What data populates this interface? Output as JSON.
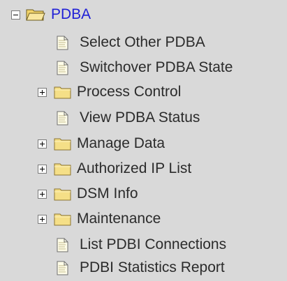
{
  "tree": {
    "root": {
      "label": "PDBA",
      "expanded": true,
      "icon": "folder-open-icon"
    },
    "items": [
      {
        "label": "Select Other PDBA",
        "type": "page",
        "icon": "page-icon"
      },
      {
        "label": "Switchover PDBA State",
        "type": "page",
        "icon": "page-icon"
      },
      {
        "label": "Process Control",
        "type": "folder",
        "icon": "folder-icon",
        "expanded": false
      },
      {
        "label": "View PDBA Status",
        "type": "page",
        "icon": "page-icon"
      },
      {
        "label": "Manage Data",
        "type": "folder",
        "icon": "folder-icon",
        "expanded": false
      },
      {
        "label": "Authorized IP List",
        "type": "folder",
        "icon": "folder-icon",
        "expanded": false
      },
      {
        "label": "DSM Info",
        "type": "folder",
        "icon": "folder-icon",
        "expanded": false
      },
      {
        "label": "Maintenance",
        "type": "folder",
        "icon": "folder-icon",
        "expanded": false
      },
      {
        "label": "List PDBI Connections",
        "type": "page",
        "icon": "page-icon"
      },
      {
        "label": "PDBI Statistics Report",
        "type": "page",
        "icon": "page-icon"
      }
    ]
  },
  "colors": {
    "background": "#d9d9d9",
    "root_text": "#1f1fd6",
    "item_text": "#2b2b2b",
    "folder_fill": "#f5df87"
  }
}
